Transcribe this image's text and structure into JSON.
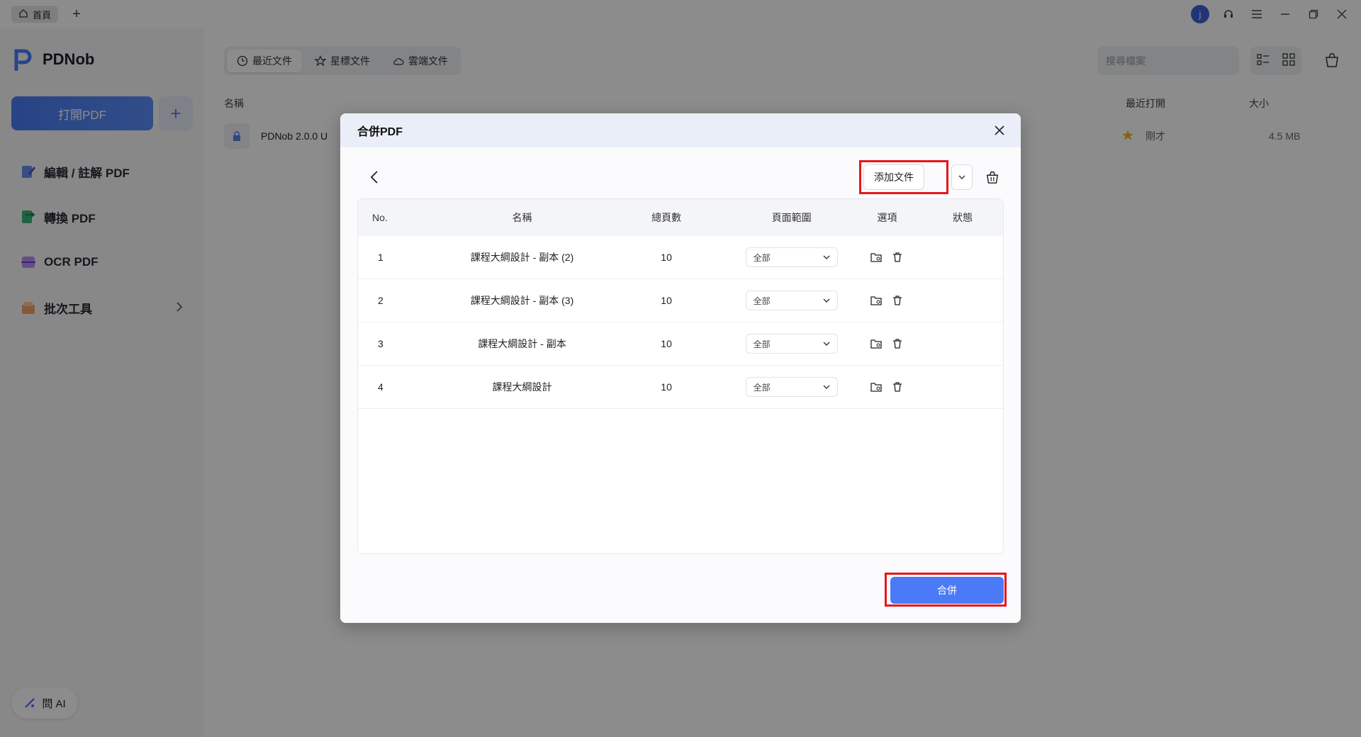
{
  "titlebar": {
    "home_tab": "首頁",
    "add_tab": "+",
    "avatar_letter": "j"
  },
  "sidebar": {
    "brand": "PDNob",
    "open_pdf": "打開PDF",
    "open_plus": "+",
    "nav": [
      {
        "label": "編輯 / 註解 PDF",
        "icon": "edit-icon"
      },
      {
        "label": "轉換 PDF",
        "icon": "convert-icon"
      },
      {
        "label": "OCR PDF",
        "icon": "ocr-icon"
      },
      {
        "label": "批次工具",
        "icon": "batch-icon"
      }
    ],
    "ask_ai": "問 AI"
  },
  "main": {
    "tabs": [
      {
        "label": "最近文件",
        "icon": "clock-icon"
      },
      {
        "label": "星標文件",
        "icon": "star-icon"
      },
      {
        "label": "雲端文件",
        "icon": "cloud-icon"
      }
    ],
    "search_placeholder": "搜尋檔案",
    "columns": {
      "name": "名稱",
      "recent": "最近打開",
      "size": "大小"
    },
    "files": [
      {
        "name": "PDNob 2.0.0 U",
        "opened": "剛才",
        "size": "4.5 MB"
      }
    ]
  },
  "dialog": {
    "title": "合併PDF",
    "add_file": "添加文件",
    "headers": {
      "no": "No.",
      "name": "名稱",
      "pages": "總頁數",
      "range": "頁面範圍",
      "options": "選項",
      "status": "狀態"
    },
    "rows": [
      {
        "no": "1",
        "name": "課程大綱設計 - 副本 (2)",
        "pages": "10",
        "range": "全部",
        "status": ""
      },
      {
        "no": "2",
        "name": "課程大綱設計 - 副本 (3)",
        "pages": "10",
        "range": "全部",
        "status": ""
      },
      {
        "no": "3",
        "name": "課程大綱設計 - 副本",
        "pages": "10",
        "range": "全部",
        "status": ""
      },
      {
        "no": "4",
        "name": "課程大綱設計",
        "pages": "10",
        "range": "全部",
        "status": ""
      }
    ],
    "merge": "合併"
  },
  "colors": {
    "accent": "#4a7af6",
    "highlight": "#e8151b",
    "star": "#f2b51c"
  }
}
